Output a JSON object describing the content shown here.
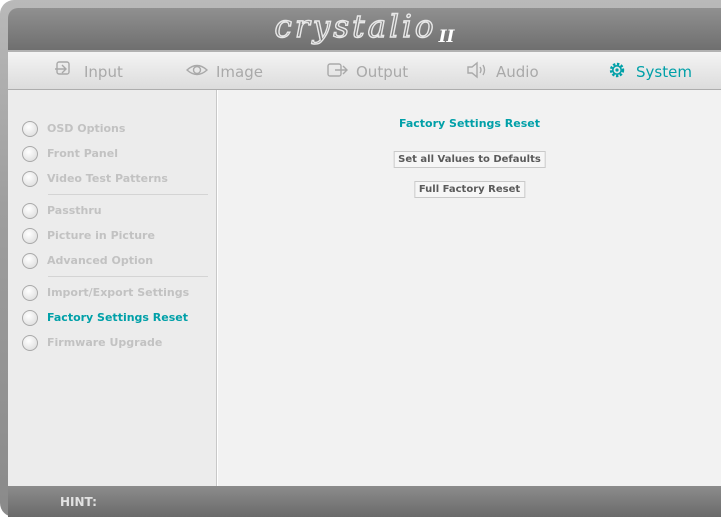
{
  "header": {
    "logo": "crystalio",
    "logo_sub": "II"
  },
  "tabs": [
    {
      "label": "Input",
      "icon": "input-icon"
    },
    {
      "label": "Image",
      "icon": "eye-icon"
    },
    {
      "label": "Output",
      "icon": "output-icon"
    },
    {
      "label": "Audio",
      "icon": "speaker-icon"
    },
    {
      "label": "System",
      "icon": "gear-icon",
      "active": true
    }
  ],
  "sidebar": {
    "items": [
      {
        "label": "OSD Options"
      },
      {
        "label": "Front Panel"
      },
      {
        "label": "Video Test Patterns"
      },
      {
        "label": "Passthru"
      },
      {
        "label": "Picture in Picture"
      },
      {
        "label": "Advanced Option"
      },
      {
        "label": "Import/Export Settings"
      },
      {
        "label": "Factory Settings Reset",
        "active": true
      },
      {
        "label": "Firmware Upgrade"
      }
    ]
  },
  "main": {
    "title": "Factory Settings Reset",
    "buttons": [
      "Set all Values to Defaults",
      "Full Factory Reset"
    ]
  },
  "footer": {
    "hint": "HINT:"
  },
  "colors": {
    "accent": "#00a0a8",
    "inactive_text": "#a9a9a9"
  }
}
